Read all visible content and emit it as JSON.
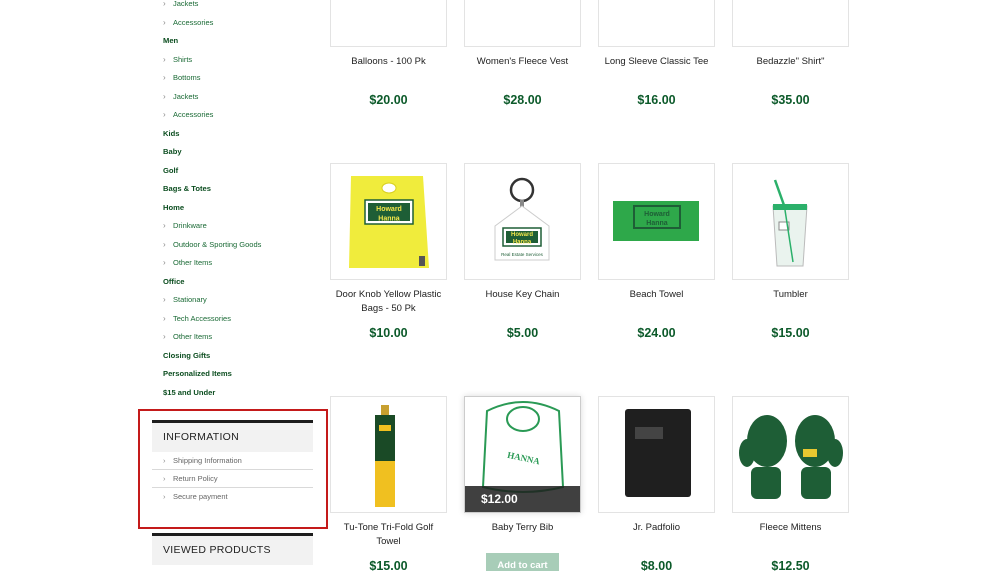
{
  "sidebar": {
    "categories": [
      {
        "label": "Jackets",
        "level": "sub"
      },
      {
        "label": "Accessories",
        "level": "sub"
      },
      {
        "label": "Men",
        "level": "top"
      },
      {
        "label": "Shirts",
        "level": "sub"
      },
      {
        "label": "Bottoms",
        "level": "sub"
      },
      {
        "label": "Jackets",
        "level": "sub"
      },
      {
        "label": "Accessories",
        "level": "sub"
      },
      {
        "label": "Kids",
        "level": "top"
      },
      {
        "label": "Baby",
        "level": "top"
      },
      {
        "label": "Golf",
        "level": "top"
      },
      {
        "label": "Bags & Totes",
        "level": "top"
      },
      {
        "label": "Home",
        "level": "top"
      },
      {
        "label": "Drinkware",
        "level": "sub"
      },
      {
        "label": "Outdoor & Sporting Goods",
        "level": "sub"
      },
      {
        "label": "Other Items",
        "level": "sub"
      },
      {
        "label": "Office",
        "level": "top"
      },
      {
        "label": "Stationary",
        "level": "sub"
      },
      {
        "label": "Tech Accessories",
        "level": "sub"
      },
      {
        "label": "Other Items",
        "level": "sub"
      },
      {
        "label": "Closing Gifts",
        "level": "top"
      },
      {
        "label": "Personalized Items",
        "level": "top"
      },
      {
        "label": "$15 and Under",
        "level": "top"
      }
    ],
    "information": {
      "title": "INFORMATION",
      "links": [
        "Shipping Information",
        "Return Policy",
        "Secure payment"
      ]
    },
    "viewed_products": {
      "title": "VIEWED PRODUCTS"
    }
  },
  "products": [
    {
      "name": "Balloons - 100 Pk",
      "price": "$20.00",
      "image": "balloons"
    },
    {
      "name": "Women's Fleece Vest",
      "price": "$28.00",
      "image": "fleece-vest"
    },
    {
      "name": "Long Sleeve Classic Tee",
      "price": "$16.00",
      "image": "long-sleeve-tee"
    },
    {
      "name": "Bedazzle\" Shirt\"",
      "price": "$35.00",
      "image": "bedazzle-shirt"
    },
    {
      "name": "Door Knob Yellow Plastic Bags - 50 Pk",
      "price": "$10.00",
      "image": "yellow-bag"
    },
    {
      "name": "House Key Chain",
      "price": "$5.00",
      "image": "key-chain"
    },
    {
      "name": "Beach Towel",
      "price": "$24.00",
      "image": "beach-towel"
    },
    {
      "name": "Tumbler",
      "price": "$15.00",
      "image": "tumbler"
    },
    {
      "name": "Tu-Tone Tri-Fold Golf Towel",
      "price": "$15.00",
      "image": "golf-towel"
    },
    {
      "name": "Baby Terry Bib",
      "price": "$12.00",
      "image": "baby-bib",
      "hovered": true,
      "overlay_price": "$12.00",
      "cart_label": "Add to cart"
    },
    {
      "name": "Jr. Padfolio",
      "price": "$8.00",
      "image": "padfolio"
    },
    {
      "name": "Fleece Mittens",
      "price": "$12.50",
      "image": "mittens"
    }
  ],
  "logo_text": {
    "line1": "Howard",
    "line2": "Hanna"
  },
  "keychain_caption": "Real Estate Services",
  "colors": {
    "brand_green": "#0c5a2a",
    "link_green": "#1a6a35",
    "highlight_red": "#c41a1a",
    "cart_button": "#a8cdb8"
  }
}
